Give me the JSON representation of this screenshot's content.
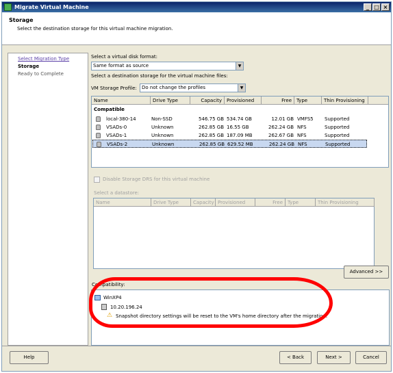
{
  "window": {
    "title": "Migrate Virtual Machine"
  },
  "header": {
    "title": "Storage",
    "subtitle": "Select the destination storage for this virtual machine migration."
  },
  "steps": [
    {
      "label": "Select Migration Type",
      "state": "link"
    },
    {
      "label": "Storage",
      "state": "current"
    },
    {
      "label": "Ready to Complete",
      "state": "future"
    }
  ],
  "disk_format": {
    "label": "Select a virtual disk format:",
    "value": "Same format as source"
  },
  "dest_label": "Select a destination storage for the virtual machine files:",
  "profile": {
    "label": "VM Storage Profile:",
    "value": "Do not change the profiles"
  },
  "table": {
    "columns": [
      "Name",
      "Drive Type",
      "Capacity",
      "Provisioned",
      "Free",
      "Type",
      "Thin Provisioning"
    ],
    "group": "Compatible",
    "rows": [
      [
        "local-380-14",
        "Non-SSD",
        "546.75 GB",
        "534.74 GB",
        "12.01 GB",
        "VMFS5",
        "Supported"
      ],
      [
        "VSADs-0",
        "Unknown",
        "262.85 GB",
        "16.55 GB",
        "262.24 GB",
        "NFS",
        "Supported"
      ],
      [
        "VSADs-1",
        "Unknown",
        "262.85 GB",
        "187.09 MB",
        "262.67 GB",
        "NFS",
        "Supported"
      ],
      [
        "VSADs-2",
        "Unknown",
        "262.85 GB",
        "629.52 MB",
        "262.24 GB",
        "NFS",
        "Supported"
      ]
    ],
    "selected_index": 3
  },
  "sdrs": {
    "label": "Disable Storage DRS for this virtual machine"
  },
  "datastore_label": "Select a datastore:",
  "table2": {
    "columns": [
      "Name",
      "Drive Type",
      "Capacity",
      "Provisioned",
      "Free",
      "Type",
      "Thin Provisioning"
    ]
  },
  "advanced_button": "Advanced >>",
  "compatibility": {
    "label": "Compatibility:",
    "vm": "WinXP4",
    "host": "10.20.196.24",
    "warning": "Snapshot directory settings will be reset to the VM's home directory after the migration."
  },
  "buttons": {
    "help": "Help",
    "back": "< Back",
    "next": "Next >",
    "cancel": "Cancel"
  },
  "colors": {
    "annotation": "#ff0000",
    "selection": "#c8d8f0",
    "titlebar": "#0a246a"
  }
}
